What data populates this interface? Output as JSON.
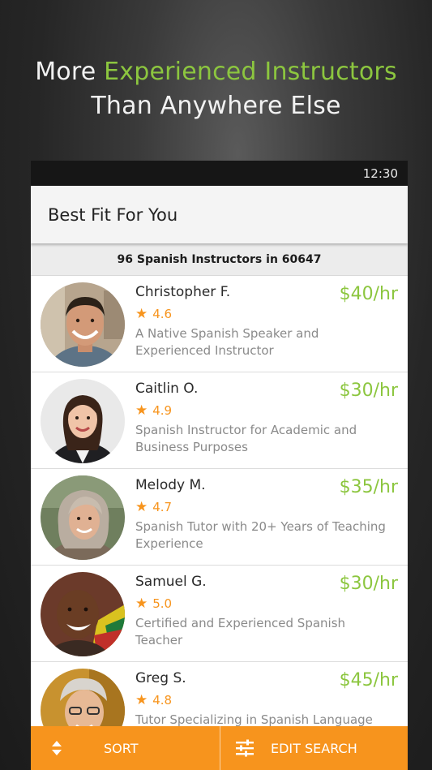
{
  "headline": {
    "line1_plain": "More ",
    "line1_accent": "Experienced Instructors",
    "line2": "Than Anywhere Else"
  },
  "status_bar": {
    "time": "12:30"
  },
  "app_bar": {
    "title": "Best Fit For You"
  },
  "subheader": {
    "text": "96 Spanish Instructors in 60647"
  },
  "instructors": [
    {
      "name": "Christopher F.",
      "rating": "4.6",
      "price": "$40/hr",
      "description": "A Native Spanish Speaker and Experienced Instructor"
    },
    {
      "name": "Caitlin O.",
      "rating": "4.9",
      "price": "$30/hr",
      "description": "Spanish Instructor for Academic and Business Purposes"
    },
    {
      "name": "Melody M.",
      "rating": "4.7",
      "price": "$35/hr",
      "description": "Spanish Tutor with 20+ Years of Teaching Experience"
    },
    {
      "name": "Samuel G.",
      "rating": "5.0",
      "price": "$30/hr",
      "description": "Certified and Experienced Spanish Teacher"
    },
    {
      "name": "Greg S.",
      "rating": "4.8",
      "price": "$45/hr",
      "description": "Tutor Specializing in Spanish Language"
    }
  ],
  "bottom_bar": {
    "sort_label": "SORT",
    "sort_icon": "sort-arrows-icon",
    "edit_label": "EDIT SEARCH",
    "edit_icon": "sliders-icon"
  },
  "colors": {
    "accent_green": "#8cc63f",
    "accent_orange": "#f7941d",
    "status_bar": "#161616",
    "app_bar": "#f4f4f4"
  }
}
